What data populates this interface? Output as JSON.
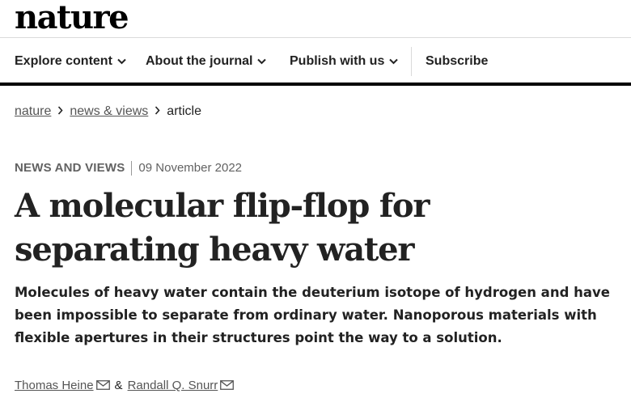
{
  "site": {
    "logo": "nature"
  },
  "nav": {
    "items": [
      {
        "label": "Explore content"
      },
      {
        "label": "About the journal"
      },
      {
        "label": "Publish with us"
      }
    ],
    "subscribe": "Subscribe"
  },
  "breadcrumb": {
    "items": [
      "nature",
      "news & views"
    ],
    "current": "article"
  },
  "article": {
    "type": "NEWS AND VIEWS",
    "date": "09 November 2022",
    "title": "A molecular flip-flop for separating heavy water",
    "standfirst": "Molecules of heavy water contain the deuterium isotope of hydrogen and have been impossible to separate from ordinary water. Nanoporous materials with flexible apertures in their structures point the way to a solution.",
    "authors": [
      "Thomas Heine",
      "Randall Q. Snurr"
    ],
    "author_joiner": "&"
  },
  "colors": {
    "text": "#222222",
    "link": "#555555",
    "meta": "#626262",
    "rule": "#000000"
  },
  "icons": {
    "nav_dropdown": "chevron-down-icon",
    "breadcrumb_sep": "chevron-right-icon",
    "author_contact": "mail-icon"
  }
}
